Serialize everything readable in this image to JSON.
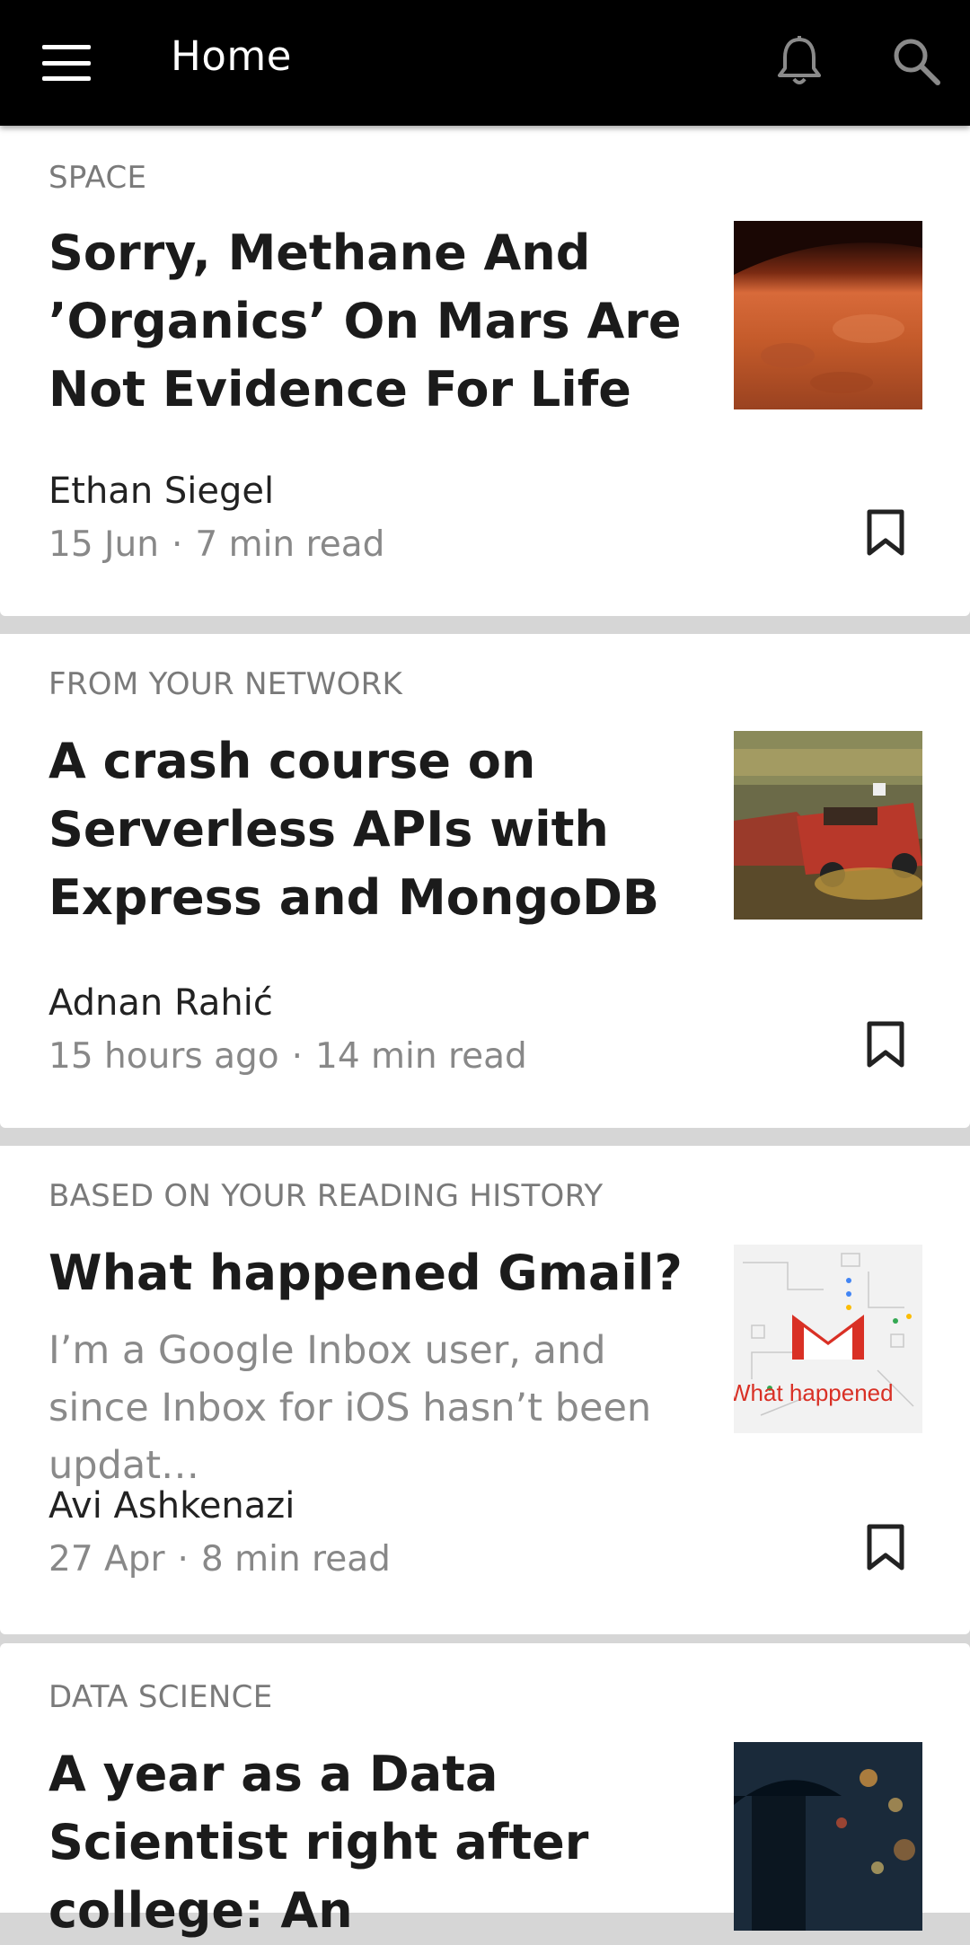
{
  "header": {
    "title": "Home",
    "menu_icon": "hamburger-menu-icon",
    "notifications_icon": "bell-icon",
    "search_icon": "search-icon"
  },
  "feed": {
    "cards": [
      {
        "topic": "SPACE",
        "headline": "Sorry, Methane And ’Organics’ On Mars Are Not Evidence For Life",
        "snippet": "",
        "author": "Ethan Siegel",
        "date": "15 Jun",
        "read_time": "7 min read",
        "thumbnail": "mars-surface-image"
      },
      {
        "topic": "FROM YOUR NETWORK",
        "headline": "A crash course on Serverless APIs with Express and MongoDB",
        "snippet": "",
        "author": "Adnan Rahić",
        "date": "15 hours ago",
        "read_time": "14 min read",
        "thumbnail": "demolition-cars-image"
      },
      {
        "topic": "BASED ON YOUR READING HISTORY",
        "headline": "What happened Gmail?",
        "snippet": "I’m a Google Inbox user, and since Inbox for iOS hasn’t been updat…",
        "author": "Avi Ashkenazi",
        "date": "27 Apr",
        "read_time": "8 min read",
        "thumbnail": "gmail-logo-image",
        "thumbnail_caption": "What happened"
      },
      {
        "topic": "DATA SCIENCE",
        "headline": "A year as a Data Scientist right after college: An",
        "snippet": "",
        "thumbnail": "umbrella-rain-image"
      }
    ]
  },
  "colors": {
    "appbar_bg": "#000000",
    "card_bg": "#ffffff",
    "feed_bg": "#d6d6d6",
    "gmail_red": "#d93025"
  }
}
